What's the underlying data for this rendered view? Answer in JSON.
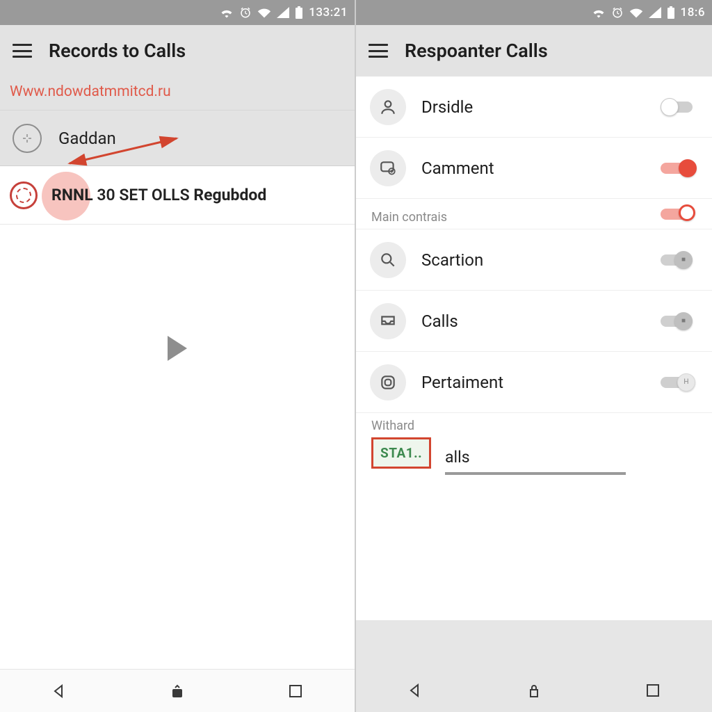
{
  "left": {
    "status": {
      "time": "133:21"
    },
    "appbar": {
      "title": "Records to Calls"
    },
    "url": "Www.ndowdatmmitcd.ru",
    "row1": {
      "label": "Gaddan"
    },
    "record": {
      "text_a": "RNNL",
      "text_b": "30 SET OLLS",
      "text_c": "Regubdod"
    }
  },
  "right": {
    "status": {
      "time": "18:6"
    },
    "appbar": {
      "title": "Respoanter Calls"
    },
    "items": [
      {
        "label": "Drsidle"
      },
      {
        "label": "Camment"
      }
    ],
    "section1": "Main contrais",
    "items2": [
      {
        "label": "Scartion"
      },
      {
        "label": "Calls"
      },
      {
        "label": "Pertaiment"
      }
    ],
    "withard": {
      "header": "Withard",
      "badge": "STA1..",
      "tail": "alls"
    }
  }
}
